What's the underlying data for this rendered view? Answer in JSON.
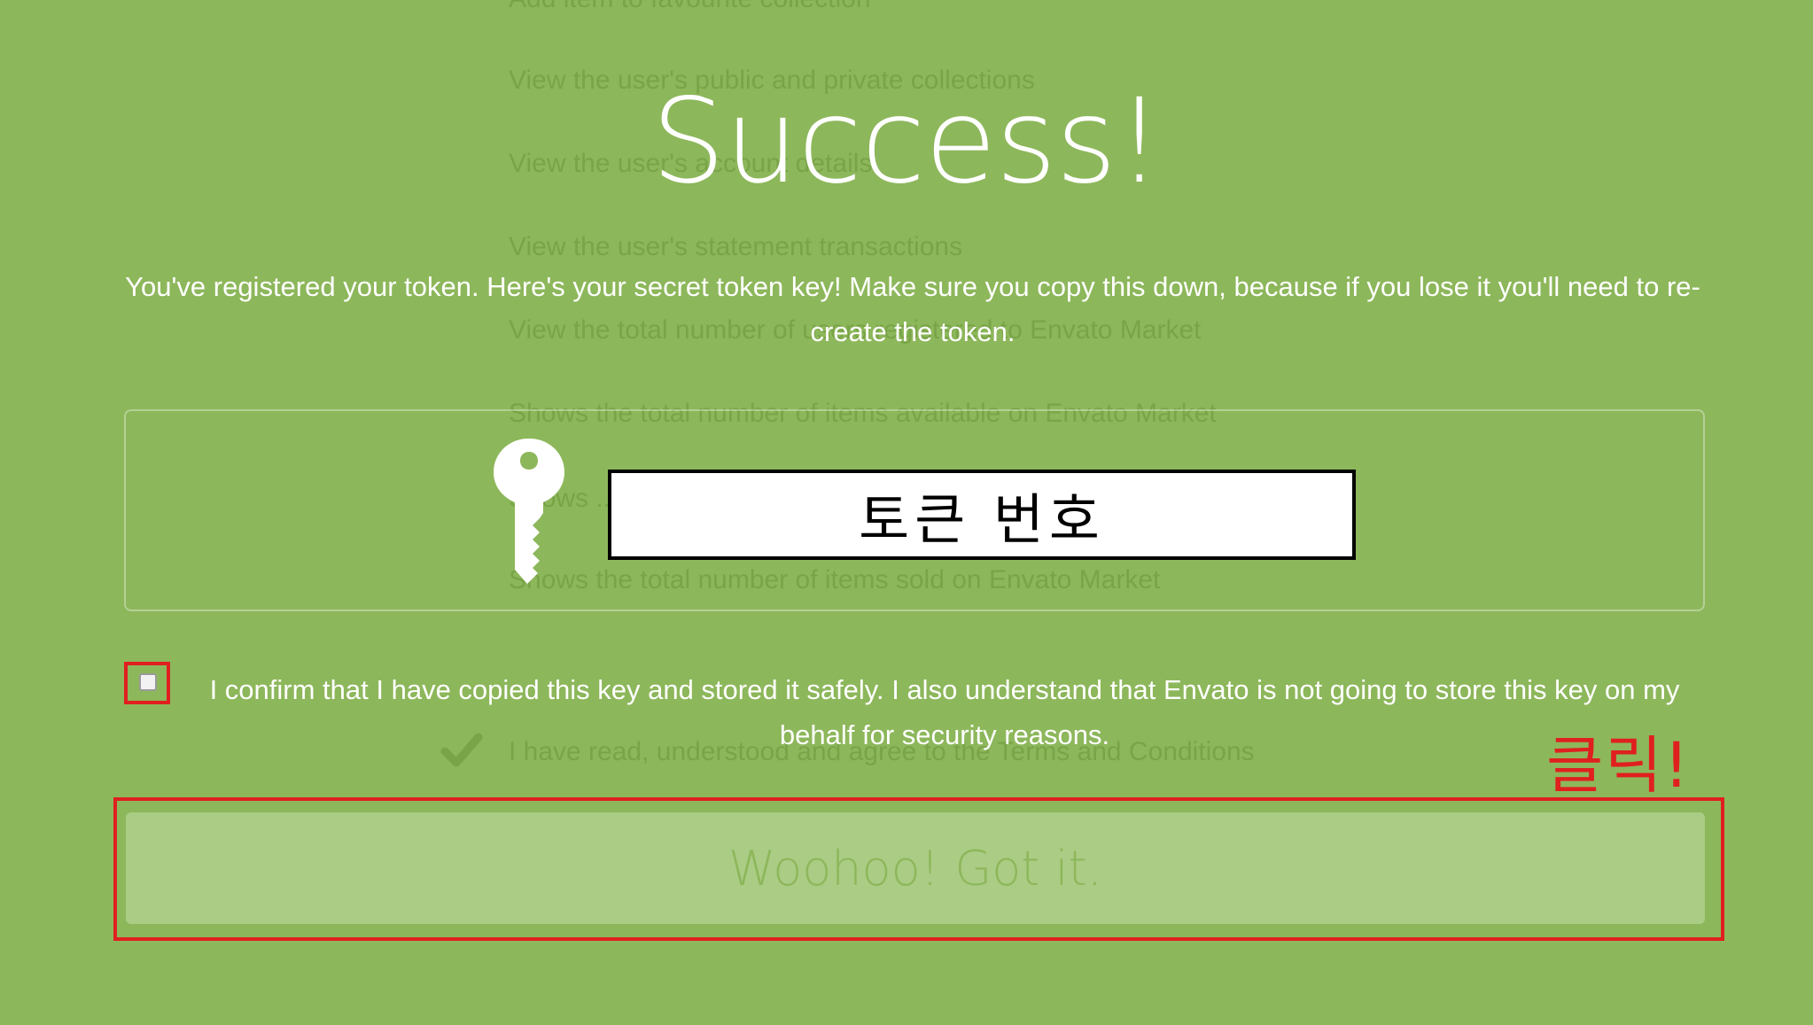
{
  "background_list": {
    "items": [
      "Add item to favourite collection",
      "View the user's public and private collections",
      "View the user's account details",
      "View the user's statement transactions",
      "View the total number of users registered to Envato Market",
      "Shows the total number of items available on Envato Market",
      "Shows ...",
      "Shows the total number of items sold on Envato Market",
      "I have read, understood and agree to the Terms and Conditions"
    ]
  },
  "modal": {
    "title": "Success!",
    "description": "You've registered your token. Here's your secret token key! Make sure you copy this down, because if you lose it you'll need to re-create the token.",
    "token_value": "토큰 번호",
    "confirm_text": "I confirm that I have copied this key and stored it safely. I also understand that Envato is not going to store this key on my behalf for security reasons.",
    "checkbox_checked": false,
    "button_label": "Woohoo! Got it."
  },
  "annotation": {
    "click_label": "클릭!",
    "color": "#e0201f"
  },
  "colors": {
    "background": "#8db75b",
    "button_bg": "#abcc84",
    "text": "#ffffff"
  }
}
